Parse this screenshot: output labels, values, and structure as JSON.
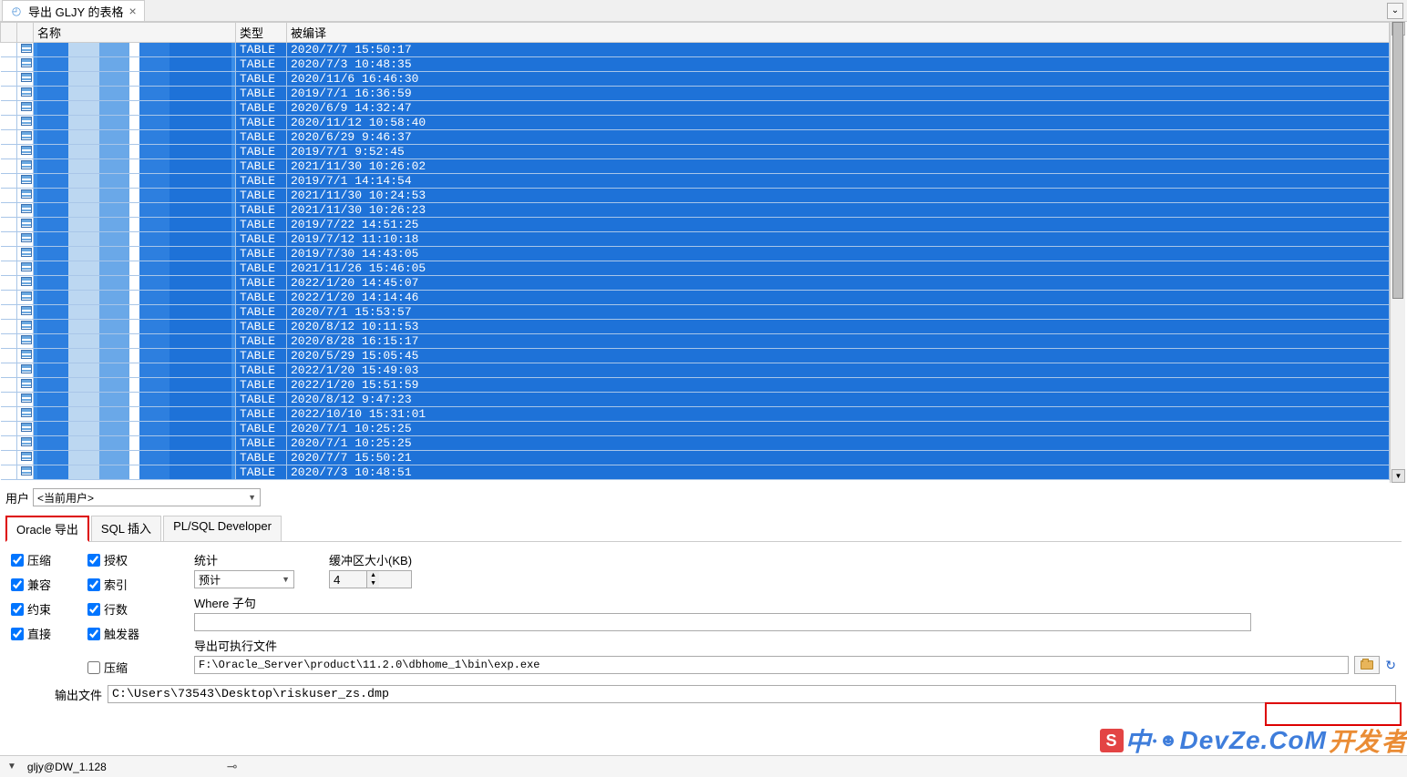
{
  "tab": {
    "title": "导出 GLJY 的表格"
  },
  "table": {
    "headers": {
      "name": "名称",
      "type": "类型",
      "compiled": "被编译"
    },
    "rows": [
      {
        "type": "TABLE",
        "compiled": "2020/7/7 15:50:17"
      },
      {
        "type": "TABLE",
        "compiled": "2020/7/3 10:48:35"
      },
      {
        "type": "TABLE",
        "compiled": "2020/11/6 16:46:30"
      },
      {
        "type": "TABLE",
        "compiled": "2019/7/1 16:36:59"
      },
      {
        "type": "TABLE",
        "compiled": "2020/6/9 14:32:47"
      },
      {
        "type": "TABLE",
        "compiled": "2020/11/12 10:58:40"
      },
      {
        "type": "TABLE",
        "compiled": "2020/6/29 9:46:37"
      },
      {
        "type": "TABLE",
        "compiled": "2019/7/1 9:52:45"
      },
      {
        "type": "TABLE",
        "compiled": "2021/11/30 10:26:02"
      },
      {
        "type": "TABLE",
        "compiled": "2019/7/1 14:14:54"
      },
      {
        "type": "TABLE",
        "compiled": "2021/11/30 10:24:53"
      },
      {
        "type": "TABLE",
        "compiled": "2021/11/30 10:26:23"
      },
      {
        "type": "TABLE",
        "compiled": "2019/7/22 14:51:25"
      },
      {
        "type": "TABLE",
        "compiled": "2019/7/12 11:10:18"
      },
      {
        "type": "TABLE",
        "compiled": "2019/7/30 14:43:05"
      },
      {
        "type": "TABLE",
        "compiled": "2021/11/26 15:46:05"
      },
      {
        "type": "TABLE",
        "compiled": "2022/1/20 14:45:07"
      },
      {
        "type": "TABLE",
        "compiled": "2022/1/20 14:14:46"
      },
      {
        "type": "TABLE",
        "compiled": "2020/7/1 15:53:57"
      },
      {
        "type": "TABLE",
        "compiled": "2020/8/12 10:11:53"
      },
      {
        "type": "TABLE",
        "compiled": "2020/8/28 16:15:17"
      },
      {
        "type": "TABLE",
        "compiled": "2020/5/29 15:05:45"
      },
      {
        "type": "TABLE",
        "compiled": "2022/1/20 15:49:03"
      },
      {
        "type": "TABLE",
        "compiled": "2022/1/20 15:51:59"
      },
      {
        "type": "TABLE",
        "compiled": "2020/8/12 9:47:23"
      },
      {
        "type": "TABLE",
        "compiled": "2022/10/10 15:31:01"
      },
      {
        "type": "TABLE",
        "compiled": "2020/7/1 10:25:25"
      },
      {
        "type": "TABLE",
        "compiled": "2020/7/1 10:25:25"
      },
      {
        "type": "TABLE",
        "compiled": "2020/7/7 15:50:21"
      },
      {
        "type": "TABLE",
        "compiled": "2020/7/3 10:48:51"
      }
    ]
  },
  "user": {
    "label": "用户",
    "value": "<当前用户>"
  },
  "subtabs": {
    "oracle": "Oracle 导出",
    "sql": "SQL 插入",
    "plsql": "PL/SQL Developer"
  },
  "checks": {
    "compress": "压缩",
    "compat": "兼容",
    "constraint": "约束",
    "direct": "直接",
    "grant": "授权",
    "index": "索引",
    "rows": "行数",
    "trigger": "触发器",
    "compress2": "压缩"
  },
  "fields": {
    "stats_label": "统计",
    "stats_value": "预计",
    "buffer_label": "缓冲区大小(KB)",
    "buffer_value": "4",
    "where_label": "Where 子句",
    "where_value": "",
    "exec_label": "导出可执行文件",
    "exec_value": "F:\\Oracle_Server\\product\\11.2.0\\dbhome_1\\bin\\exp.exe",
    "output_label": "输出文件",
    "output_value": "C:\\Users\\73543\\Desktop\\riskuser_zs.dmp"
  },
  "status": {
    "connection": "gljy@DW_1.128"
  },
  "watermark": {
    "cn": "中",
    "brand1": "开发",
    "brand2": "者",
    "domain": "DevZe.CoM"
  }
}
